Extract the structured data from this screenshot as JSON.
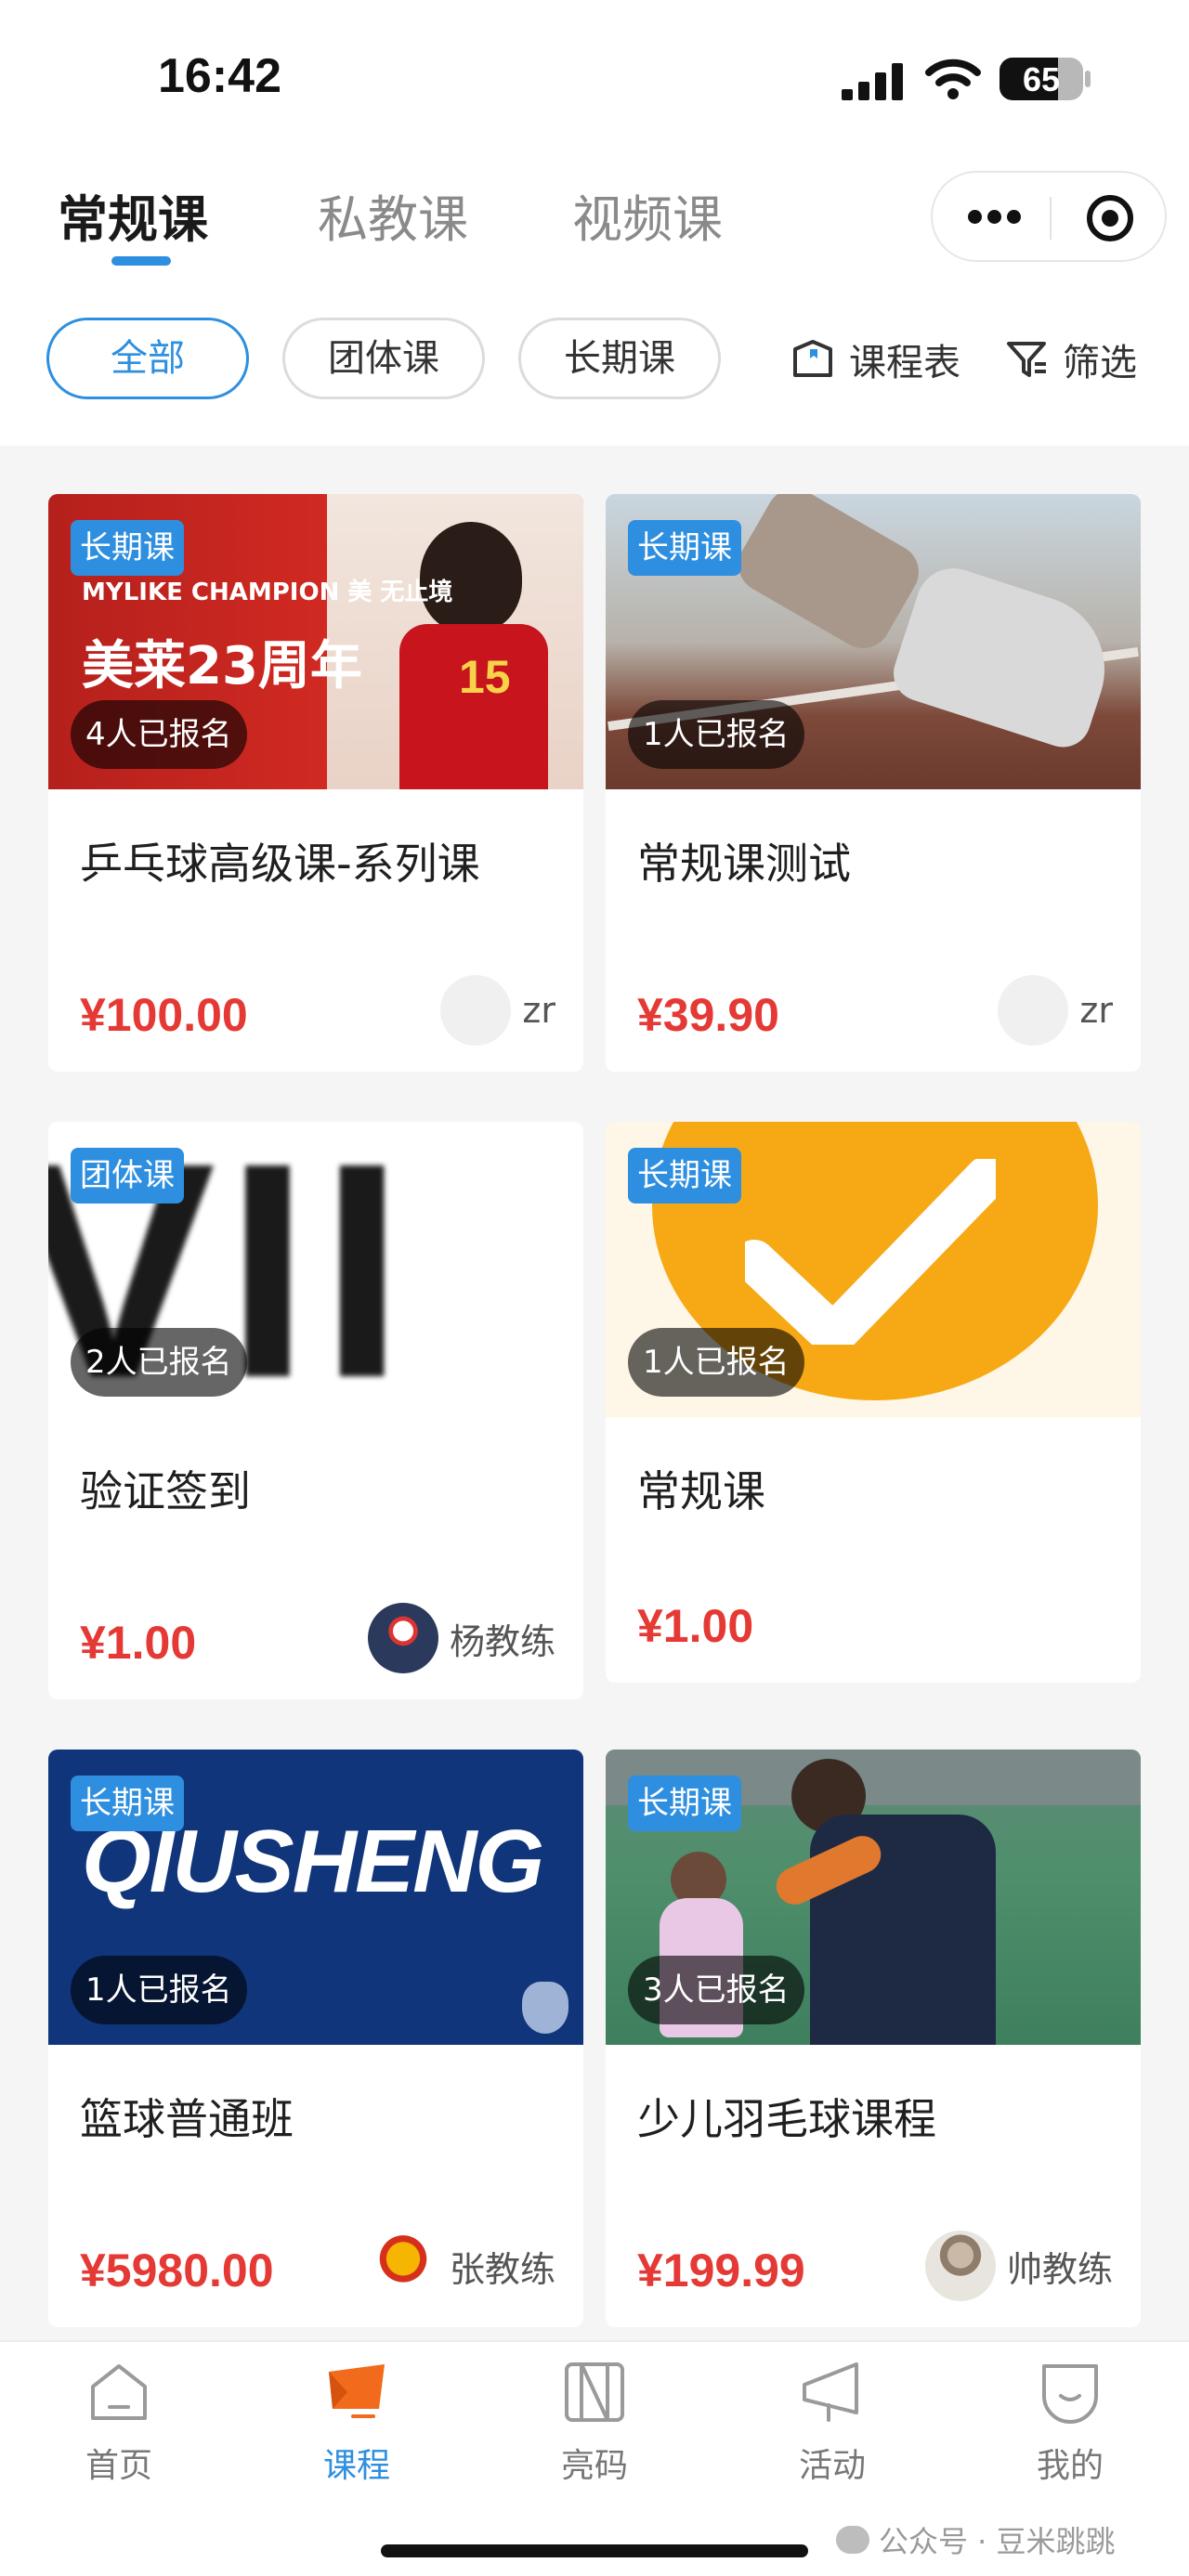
{
  "status_bar": {
    "time": "16:42",
    "battery": "65"
  },
  "top_tabs": [
    {
      "label": "常规课",
      "active": true
    },
    {
      "label": "私教课",
      "active": false
    },
    {
      "label": "视频课",
      "active": false
    }
  ],
  "filters": {
    "chips": [
      {
        "label": "全部",
        "active": true
      },
      {
        "label": "团体课",
        "active": false
      },
      {
        "label": "长期课",
        "active": false
      }
    ],
    "schedule_label": "课程表",
    "filter_label": "筛选"
  },
  "courses": [
    {
      "tag": "长期课",
      "enrolled": "4人已报名",
      "title": "乒乓球高级课-系列课",
      "price": "¥100.00",
      "coach": "zr",
      "image_text": [
        "MYLIKE CHAMPION 美 无止境",
        "美莱23周年",
        "15"
      ]
    },
    {
      "tag": "长期课",
      "enrolled": "1人已报名",
      "title": "常规课测试",
      "price": "¥39.90",
      "coach": "zr"
    },
    {
      "tag": "团体课",
      "enrolled": "2人已报名",
      "title": "验证签到",
      "price": "¥1.00",
      "coach": "杨教练",
      "image_text": [
        "VII"
      ]
    },
    {
      "tag": "长期课",
      "enrolled": "1人已报名",
      "title": "常规课",
      "price": "¥1.00",
      "coach": ""
    },
    {
      "tag": "长期课",
      "enrolled": "1人已报名",
      "title": "篮球普通班",
      "price": "¥5980.00",
      "coach": "张教练",
      "image_text": [
        "QIUSHENG"
      ]
    },
    {
      "tag": "长期课",
      "enrolled": "3人已报名",
      "title": "少儿羽毛球课程",
      "price": "¥199.99",
      "coach": "帅教练"
    }
  ],
  "bottom_nav": [
    {
      "label": "首页",
      "icon": "home-icon",
      "active": false
    },
    {
      "label": "课程",
      "icon": "course-icon",
      "active": true
    },
    {
      "label": "亮码",
      "icon": "code-icon",
      "active": false
    },
    {
      "label": "活动",
      "icon": "activity-icon",
      "active": false
    },
    {
      "label": "我的",
      "icon": "profile-icon",
      "active": false
    }
  ],
  "watermark": "公众号 · 豆米跳跳",
  "colors": {
    "accent": "#2e8fe0",
    "price": "#e53935",
    "tag_bg": "#2e8fe0"
  }
}
